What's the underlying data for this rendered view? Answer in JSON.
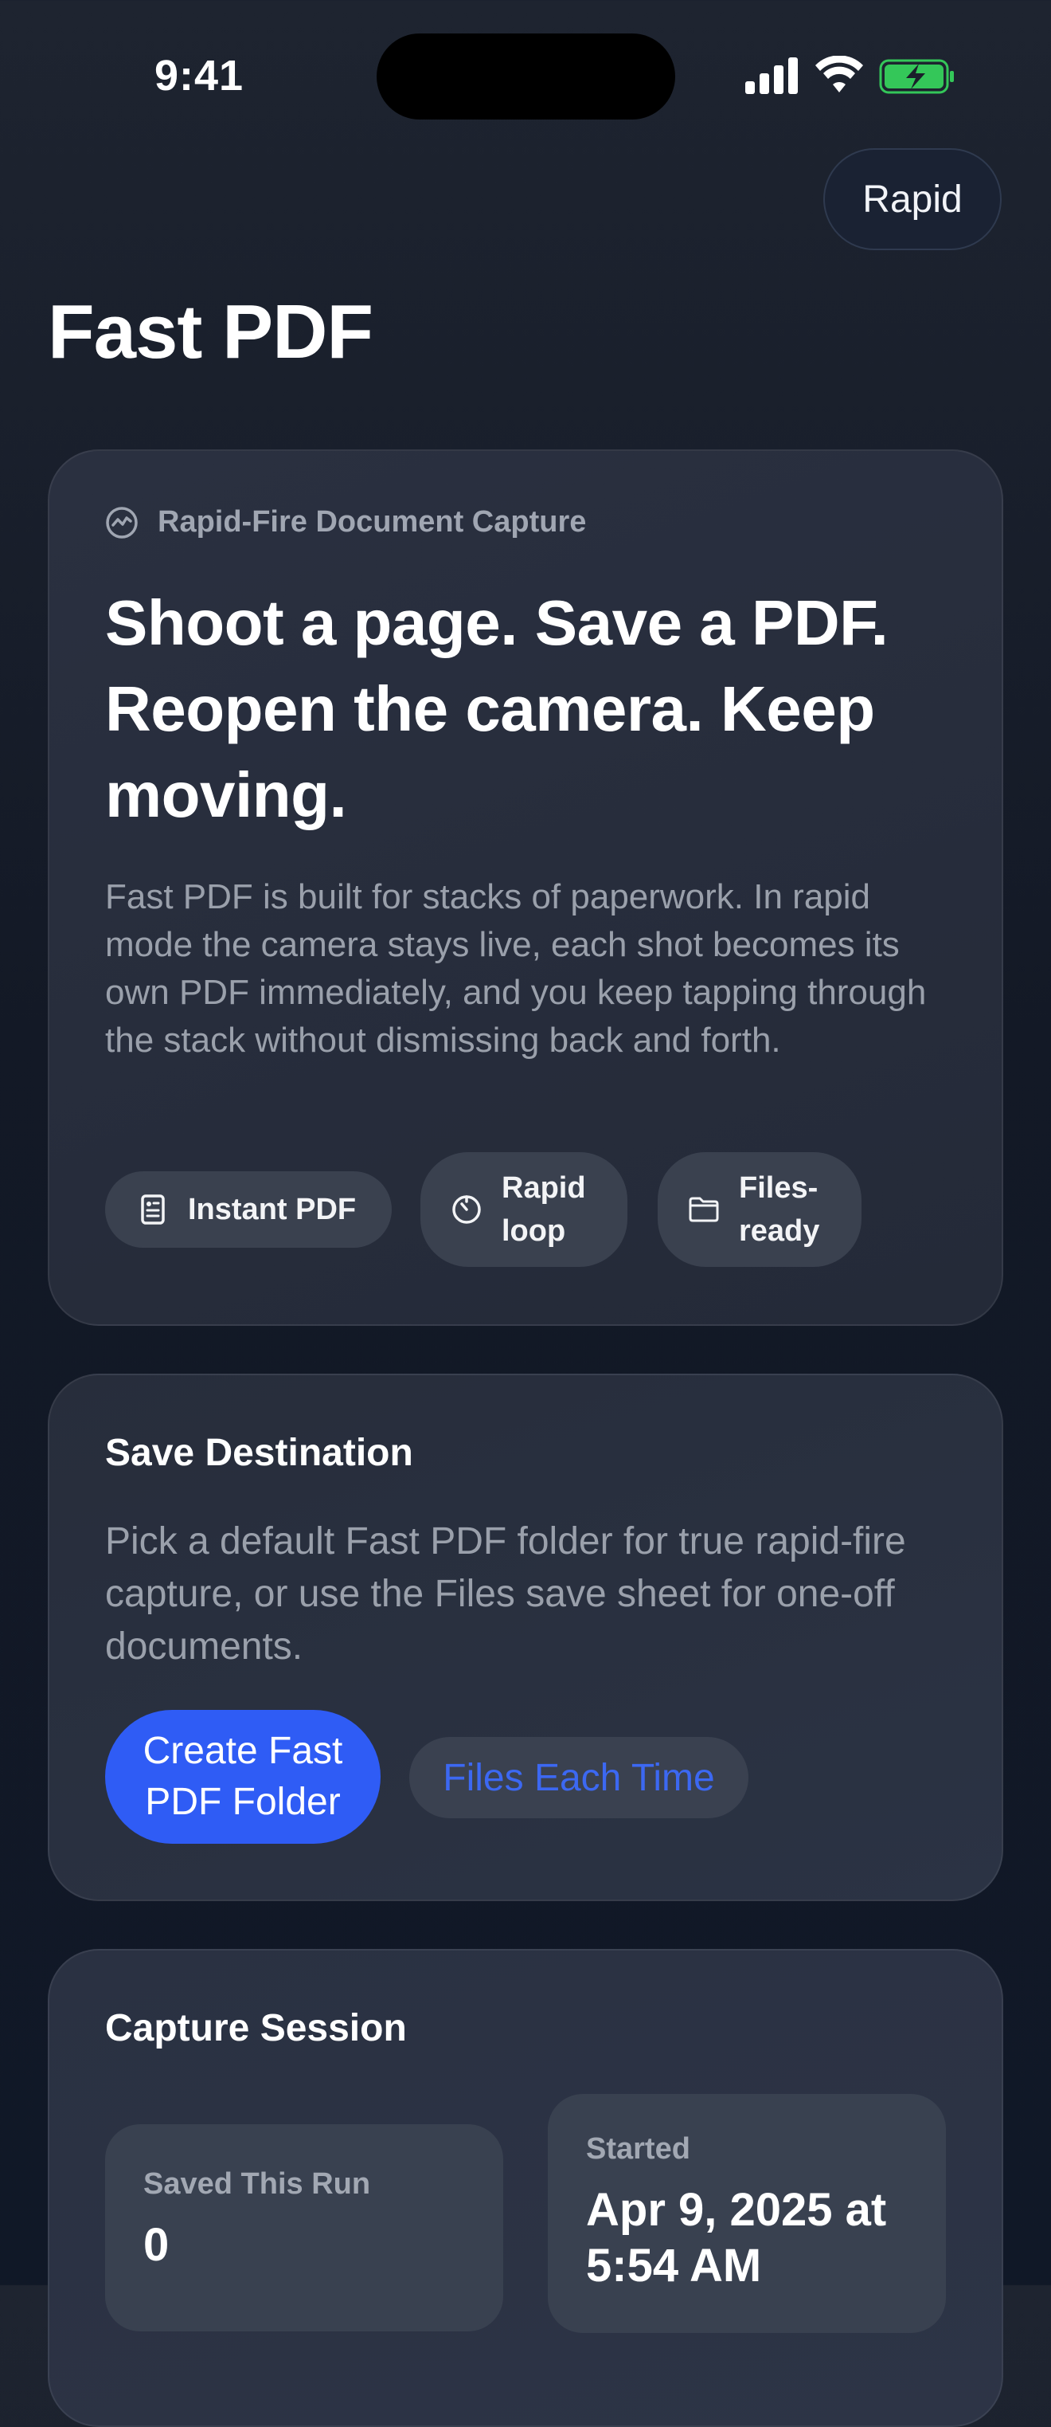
{
  "status_bar": {
    "time": "9:41"
  },
  "header": {
    "mode_label": "Rapid",
    "app_title": "Fast PDF"
  },
  "hero": {
    "eyebrow_icon": "waveform-circle-icon",
    "eyebrow": "Rapid-Fire Document Capture",
    "headline": "Shoot a page. Save a PDF. Reopen the camera. Keep moving.",
    "description": "Fast PDF is built for stacks of paperwork. In rapid mode the camera stays live, each shot becomes its own PDF immediately, and you keep tapping through the stack without dismissing back and forth.",
    "chips": [
      {
        "icon": "document-icon",
        "label": "Instant PDF"
      },
      {
        "icon": "timer-icon",
        "label_line1": "Rapid",
        "label_line2": "loop"
      },
      {
        "icon": "folder-icon",
        "label_line1": "Files-",
        "label_line2": "ready"
      }
    ]
  },
  "destination": {
    "title": "Save Destination",
    "description": "Pick a default Fast PDF folder for true rapid-fire capture, or use the Files save sheet for one-off documents.",
    "primary_line1": "Create Fast",
    "primary_line2": "PDF Folder",
    "secondary": "Files Each Time",
    "colors": {
      "primary": "#2f5cf5",
      "secondary_text": "#3c68f2"
    }
  },
  "session": {
    "title": "Capture Session",
    "saved_label": "Saved This Run",
    "saved_value": "0",
    "started_label": "Started",
    "started_value": "Apr 9, 2025 at 5:54 AM"
  }
}
